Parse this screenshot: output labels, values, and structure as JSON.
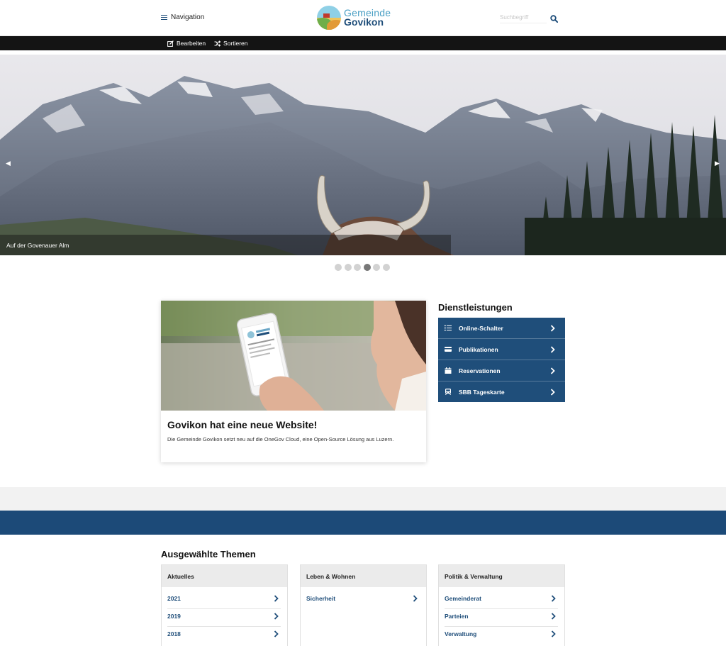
{
  "header": {
    "nav_label": "Navigation",
    "logo_line1": "Gemeinde",
    "logo_line2": "Govikon",
    "search_placeholder": "Suchbegriff"
  },
  "editbar": {
    "edit_label": "Bearbeiten",
    "sort_label": "Sortieren"
  },
  "slider": {
    "caption": "Auf der Govenauer Alm",
    "prev_symbol": "◀",
    "next_symbol": "▶",
    "dot_count": 6,
    "active_dot": 4
  },
  "news": {
    "title": "Govikon hat eine neue Website!",
    "text": "Die Gemeinde Govikon setzt neu auf die OneGov Cloud, eine Open-Source Lösung aus Luzern."
  },
  "services": {
    "title": "Dienstleistungen",
    "items": [
      {
        "label": "Online-Schalter",
        "icon": "list-icon"
      },
      {
        "label": "Publikationen",
        "icon": "credit-card-icon"
      },
      {
        "label": "Reservationen",
        "icon": "calendar-icon"
      },
      {
        "label": "SBB Tageskarte",
        "icon": "train-icon"
      }
    ]
  },
  "topics": {
    "title": "Ausgewählte Themen",
    "columns": [
      {
        "heading": "Aktuelles",
        "links": [
          "2021",
          "2019",
          "2018"
        ]
      },
      {
        "heading": "Leben & Wohnen",
        "links": [
          "Sicherheit"
        ]
      },
      {
        "heading": "Politik & Verwaltung",
        "links": [
          "Gemeinderat",
          "Parteien",
          "Verwaltung"
        ]
      }
    ]
  },
  "colors": {
    "brand_blue": "#1f4e7a",
    "band_blue": "#1c4a78",
    "editbar": "#141414"
  }
}
